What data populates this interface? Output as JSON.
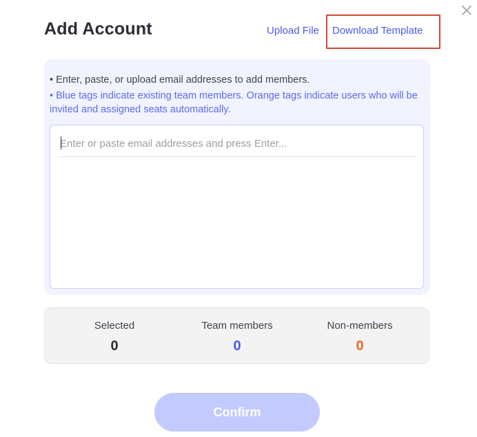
{
  "dialog": {
    "title": "Add Account",
    "upload_label": "Upload File",
    "download_label": "Download Template",
    "close_icon": "close-icon"
  },
  "instructions": {
    "line1": "• Enter, paste, or upload email addresses to add members.",
    "line2": "• Blue tags indicate existing team members. Orange tags indicate users who will be invited and assigned seats automatically."
  },
  "email_input": {
    "value": "",
    "placeholder": "Enter or paste email addresses and press Enter..."
  },
  "stats": {
    "selected_label": "Selected",
    "selected_value": "0",
    "team_label": "Team members",
    "team_value": "0",
    "non_label": "Non-members",
    "non_value": "0"
  },
  "confirm_label": "Confirm",
  "colors": {
    "accent": "#4a5ae8",
    "orange": "#ec6a1e",
    "confirm_disabled": "#c3caff",
    "highlight": "#d24a33"
  }
}
